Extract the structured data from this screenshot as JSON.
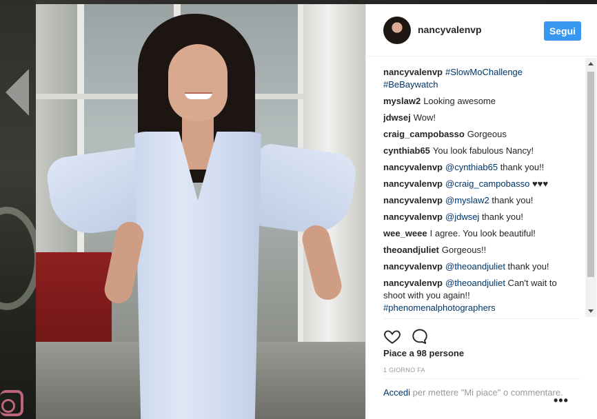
{
  "post": {
    "username": "nancyvalenvp",
    "follow_label": "Segui",
    "likes_text": "Piace a 98 persone",
    "time_text": "1 GIORNO FA",
    "login_link": "Accedi",
    "login_prompt": "per mettere \"Mi piace\" o commentare.",
    "more_label": "•••"
  },
  "comments": [
    {
      "user": "nancyvalenvp",
      "text": "",
      "tag": "#SlowMoChallenge #BeBaywatch"
    },
    {
      "user": "myslaw2",
      "text": "Looking awesome",
      "tag": ""
    },
    {
      "user": "jdwsej",
      "text": "Wow!",
      "tag": ""
    },
    {
      "user": "craig_campobasso",
      "text": "Gorgeous",
      "tag": ""
    },
    {
      "user": "cynthiab65",
      "text": "You look fabulous Nancy!",
      "tag": ""
    },
    {
      "user": "nancyvalenvp",
      "tag": "@cynthiab65",
      "text": " thank you!!"
    },
    {
      "user": "nancyvalenvp",
      "tag": "@craig_campobasso",
      "text": " ♥♥♥"
    },
    {
      "user": "nancyvalenvp",
      "tag": "@myslaw2",
      "text": " thank you!"
    },
    {
      "user": "nancyvalenvp",
      "tag": "@jdwsej",
      "text": " thank you!"
    },
    {
      "user": "wee_weee",
      "text": "I agree. You look beautiful!",
      "tag": ""
    },
    {
      "user": "theoandjuliet",
      "text": "Gorgeous!!",
      "tag": ""
    },
    {
      "user": "nancyvalenvp",
      "tag": "@theoandjuliet",
      "text": " thank you!"
    },
    {
      "user": "nancyvalenvp",
      "tag": "@theoandjuliet",
      "text": " Can't wait to shoot with you again!! ",
      "tag2": "#phenomenalphotographers"
    }
  ],
  "icons": {
    "like": "heart-icon",
    "comment": "comment-bubble-icon",
    "more": "more-options-icon"
  },
  "colors": {
    "accent": "#3897f0",
    "link": "#003569",
    "text": "#262626",
    "muted": "#999999"
  }
}
